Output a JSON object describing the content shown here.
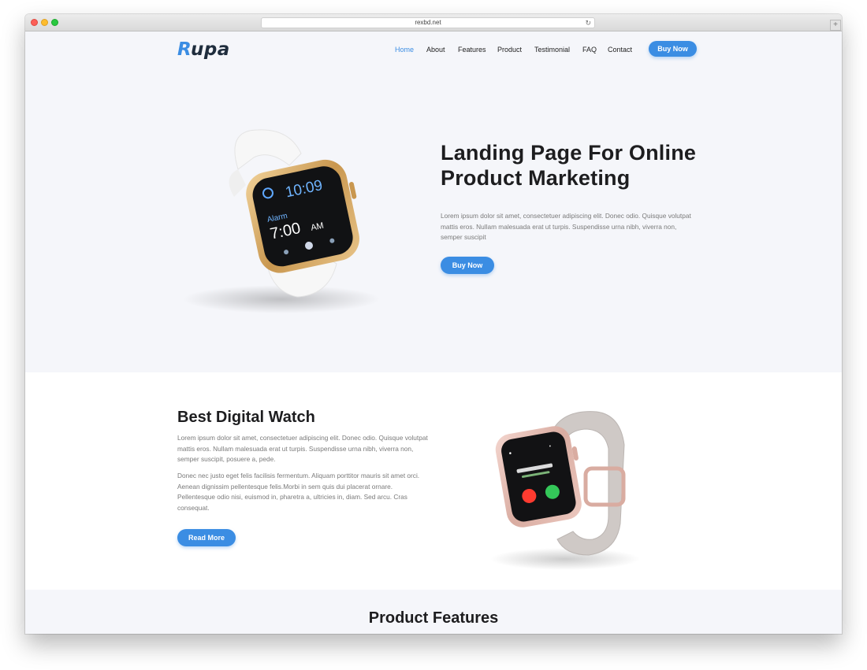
{
  "browser": {
    "url": "rexbd.net"
  },
  "brand": {
    "initial": "R",
    "rest": "upa"
  },
  "nav": {
    "items": [
      "Home",
      "About",
      "Features",
      "Product",
      "Testimonial",
      "FAQ",
      "Contact"
    ],
    "active": "Home",
    "cta": "Buy Now"
  },
  "hero": {
    "title_line1": "Landing Page For Online",
    "title_line2": "Product Marketing",
    "text": "Lorem ipsum dolor sit amet, consectetuer adipiscing elit. Donec odio. Quisque volutpat mattis eros. Nullam malesuada erat ut turpis. Suspendisse urna nibh, viverra non, semper suscipit",
    "button": "Buy Now",
    "watch_screen": {
      "time": "10:09",
      "alarm_label": "Alarm",
      "alarm_time": "7:00",
      "alarm_suffix": "AM"
    }
  },
  "digital": {
    "title": "Best Digital Watch",
    "paragraph1": "Lorem ipsum dolor sit amet, consectetuer adipiscing elit. Donec odio. Quisque volutpat mattis eros. Nullam malesuada erat ut turpis. Suspendisse urna nibh, viverra non, semper suscipit, posuere a, pede.",
    "paragraph2": "Donec nec justo eget felis facilisis fermentum. Aliquam porttitor mauris sit amet orci. Aenean dignissim pellentesque felis.Morbi in sem quis dui placerat ornare. Pellentesque odio nisi, euismod in, pharetra a, ultricies in, diam. Sed arcu. Cras consequat.",
    "button": "Read More"
  },
  "features": {
    "title": "Product Features"
  },
  "colors": {
    "accent": "#3b8de3",
    "heading": "#1d1d1f",
    "body_text": "#7a7a7a",
    "page_bg": "#f5f6fa"
  }
}
